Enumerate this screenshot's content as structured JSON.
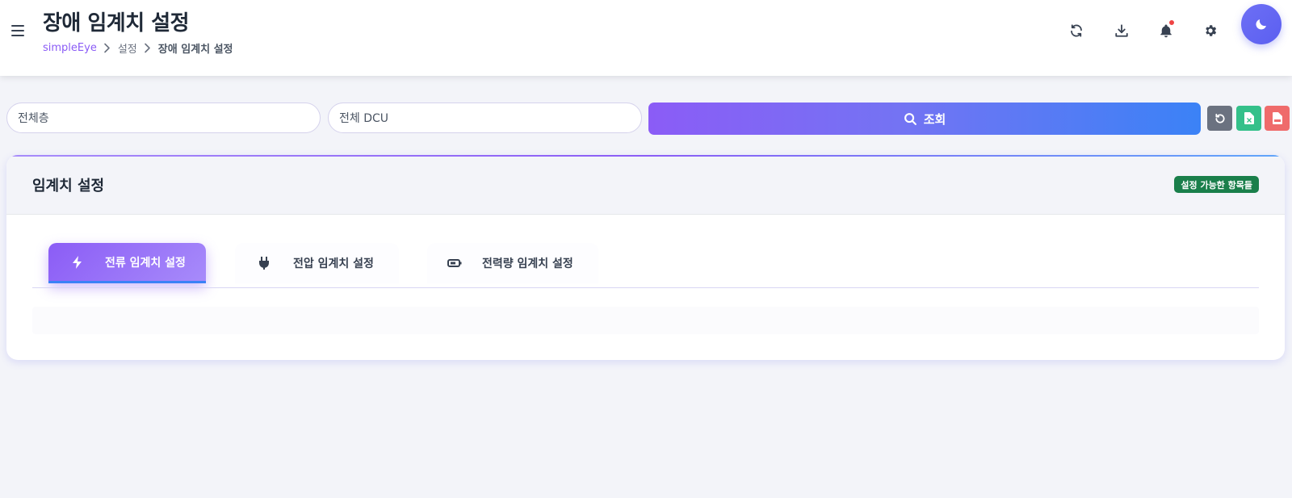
{
  "header": {
    "title": "장애 임계치 설정",
    "breadcrumb": {
      "home": "simpleEye",
      "parent": "설정",
      "current": "장애 임계치 설정"
    },
    "icons": [
      "refresh-icon",
      "download-icon",
      "bell-icon",
      "gear-icon",
      "moon-icon"
    ],
    "notification_dot_color": "#ef4444"
  },
  "filters": {
    "floor_value": "전체층",
    "dcu_value": "전체 DCU",
    "search_label": "조회"
  },
  "actions": {
    "reset": "undo-icon",
    "excel": "excel-file-icon",
    "pdf": "pdf-file-icon"
  },
  "card": {
    "title": "임계치 설정",
    "badge": "설정 가능한 항목들",
    "tabs": [
      {
        "label": "전류 임계치 설정",
        "icon": "bolt-icon",
        "active": true
      },
      {
        "label": "전압 임계치 설정",
        "icon": "plug-icon",
        "active": false
      },
      {
        "label": "전력량 임계치 설정",
        "icon": "battery-icon",
        "active": false
      }
    ]
  },
  "colors": {
    "accent": "#8b5cf6",
    "accent_blue": "#3b82f6",
    "badge_green": "#1a7f4b",
    "reset_gray": "#6b7280",
    "excel_green": "#34c08a",
    "pdf_red": "#ef6b6b"
  }
}
